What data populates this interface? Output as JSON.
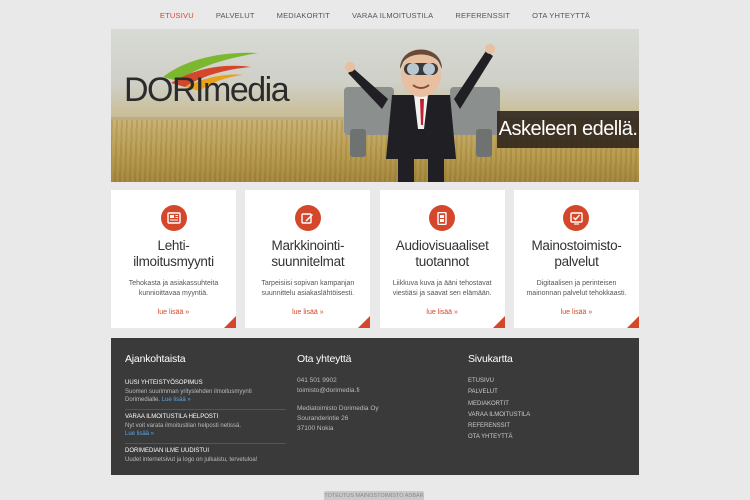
{
  "nav": [
    {
      "label": "ETUSIVU",
      "active": true
    },
    {
      "label": "PALVELUT",
      "active": false
    },
    {
      "label": "MEDIAKORTIT",
      "active": false
    },
    {
      "label": "VARAA ILMOITUSTILA",
      "active": false
    },
    {
      "label": "REFERENSSIT",
      "active": false
    },
    {
      "label": "OTA YHTEYTTÄ",
      "active": false
    }
  ],
  "hero": {
    "logo_text": "DORImedia",
    "tagline": "Askeleen edellä."
  },
  "cards": [
    {
      "icon": "newspaper-icon",
      "title": "Lehti-\nilmoitusmyynti",
      "text": "Tehokasta ja asiakassuhteita kunnioittavaa myyntiä.",
      "more": "lue lisää »"
    },
    {
      "icon": "edit-icon",
      "title": "Markkinointi-\nsuunnitelmat",
      "text": "Tarpeisiisi sopivan kampanjan suunnittelu asiakaslähtöisesti.",
      "more": "lue lisää »"
    },
    {
      "icon": "film-icon",
      "title": "Audiovisuaaliset\ntuotannot",
      "text": "Liikkuva kuva ja ääni tehostavat viestiäsi ja saavat sen elämään.",
      "more": "lue lisää »"
    },
    {
      "icon": "check-box-icon",
      "title": "Mainostoimisto-\npalvelut",
      "text": "Digitaalisen ja perinteisen mainonnan palvelut tehokkaasti.",
      "more": "lue lisää »"
    }
  ],
  "footer": {
    "news_title": "Ajankohtaista",
    "news": [
      {
        "title": "UUSI YHTEISTYÖSOPIMUS",
        "text": "Suomen suurimman yrityslehden ilmoitusmyynti Dorimedialle.",
        "more": "Lue lisää »"
      },
      {
        "title": "VARAA ILMOITUSTILA HELPOSTI",
        "text": "Nyt voit varata ilmoitustilan helposti netissä.",
        "more": "Lue lisää »"
      },
      {
        "title": "DORIMEDIAN ILME UUDISTUI",
        "text": "Uudet internetsivut ja logo on julkaistu, tervetuloa!",
        "more": ""
      }
    ],
    "contact_title": "Ota yhteyttä",
    "phone": "041 501 9902",
    "email": "toimisto@dorimedia.fi",
    "company": "Mediatoimisto Dorimedia Oy",
    "street": "Souranderintie 26",
    "city": "37100 Nokia",
    "sitemap_title": "Sivukartta",
    "sitemap": [
      "ETUSIVU",
      "PALVELUT",
      "MEDIAKORTIT",
      "VARAA ILMOITUSTILA",
      "REFERENSSIT",
      "OTA YHTEYTTÄ"
    ]
  },
  "credit": "TOTEUTUS MAINOSTOIMISTO ADBAR",
  "colors": {
    "accent": "#d4472a",
    "footer_bg": "#3a3a3a",
    "page_bg": "#e9e9e9",
    "link_blue": "#5aa6e8"
  }
}
